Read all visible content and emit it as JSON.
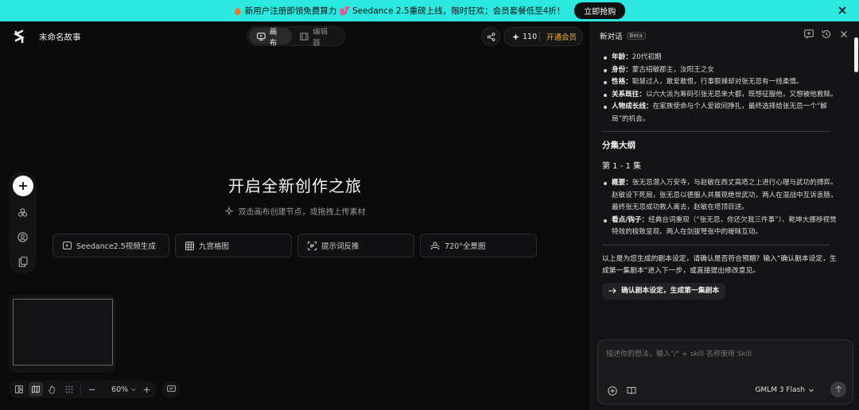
{
  "banner": {
    "message": "新用户注册即领免费算力 💕 Seedance 2.5重磅上线，限时狂欢：会员套餐低至4折！",
    "cta": "立即抢购"
  },
  "header": {
    "story_title": "未命名故事",
    "modes": [
      {
        "label": "画布",
        "active": true
      },
      {
        "label": "编辑器",
        "active": false
      }
    ],
    "credits": "110",
    "vip_label": "开通会员"
  },
  "canvas": {
    "title": "开启全新创作之旅",
    "subtitle": "双击画布创建节点，或拖拽上传素材",
    "quick_actions": [
      {
        "label": "Seedance2.5视频生成",
        "icon": "video-icon"
      },
      {
        "label": "九宫格图",
        "icon": "grid-icon"
      },
      {
        "label": "提示词反推",
        "icon": "scan-icon"
      },
      {
        "label": "720°全景图",
        "icon": "panorama-icon"
      }
    ],
    "zoom": "60%"
  },
  "panel": {
    "title": "新对话",
    "badge": "Beta",
    "character": [
      {
        "key": "年龄：",
        "value": "20代初期"
      },
      {
        "key": "身份：",
        "value": "蒙古绍敏郡主，汝阳王之女"
      },
      {
        "key": "性格：",
        "value": "聪慧过人，敢爱敢恨，行事狠辣却对张无忌有一线柔情。"
      },
      {
        "key": "关系既往：",
        "value": "以六大派为筹码引张无忌来大都，既想征服他，又想被他救赎。"
      },
      {
        "key": "人物成长线：",
        "value": "在家族使命与个人爱欲间挣扎，最终选择给张无忌一个“解局”的机会。"
      }
    ],
    "outline_heading": "分集大纲",
    "episode_heading": "第 1 - 1 集",
    "episode": [
      {
        "key": "概要：",
        "value": "张无忌潜入万安寺，与赵敏在西丈高塔之上进行心理与武功的搏弈。赵敏设下死局，张无忌以德服人并展现绝世武功，两人在混战中互诉衷肠，最终张无忌成功救人离去，赵敏在塔顶目送。"
      },
      {
        "key": "看点/钩子：",
        "value": "经典台词重现（“张无忌，你还欠我三件事”）、乾坤大挪移视觉特效的极致呈现、两人在剑拔弩张中的暧昧互动。"
      }
    ],
    "question": "以上是为您生成的剧本设定，请确认是否符合预期？输入“确认剧本设定，生成第一集剧本”进入下一步，或直接提出修改意见。",
    "confirm_button": "确认剧本设定，生成第一集剧本",
    "composer_placeholder": "描述你的想法，输入\"/\" + skill 名称使用 Skill",
    "model": "GMLM 3 Flash"
  }
}
